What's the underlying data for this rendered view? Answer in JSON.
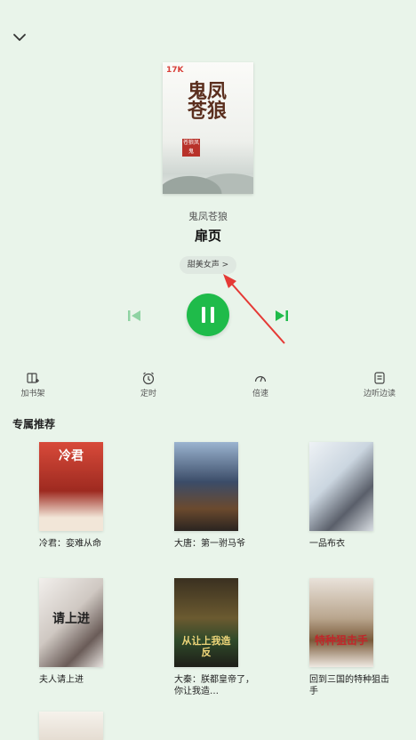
{
  "player": {
    "author": "鬼凤苍狼",
    "chapter_title": "扉页",
    "voice_label": "甜美女声 >",
    "cover": {
      "publisher_logo": "17K",
      "calligraphy": "鬼凤苍狼",
      "seal": "苍狼凤鬼"
    }
  },
  "toolbar": [
    {
      "label": "加书架",
      "icon": "bookshelf-add-icon"
    },
    {
      "label": "定时",
      "icon": "alarm-clock-icon"
    },
    {
      "label": "倍速",
      "icon": "speed-icon"
    },
    {
      "label": "边听边读",
      "icon": "read-while-listen-icon"
    }
  ],
  "recommend": {
    "title": "专属推荐",
    "books": [
      {
        "name": "冷君：娈难从命",
        "cover_text": "冷君",
        "cover_color": "#c23a2b"
      },
      {
        "name": "大唐：第一驸马爷",
        "cover_text": "",
        "cover_color": "#3b4c68"
      },
      {
        "name": "一品布衣",
        "cover_text": "",
        "cover_color": "#cbd6e0"
      },
      {
        "name": "夫人请上进",
        "cover_text": "请上进",
        "cover_color": "#e8e4e0"
      },
      {
        "name": "大秦：朕都皇帝了，你让我造…",
        "cover_text": "从让上我造反",
        "cover_color": "#5a4a25"
      },
      {
        "name": "回到三国的特种狙击手",
        "cover_text": "特种狙击手",
        "cover_color": "#d9d0c8"
      },
      {
        "name": "",
        "cover_text": "",
        "cover_color": "#f3ede6"
      }
    ]
  },
  "colors": {
    "accent": "#1fbb4a",
    "background": "#e9f4ea",
    "annotation_arrow": "#e53935"
  }
}
